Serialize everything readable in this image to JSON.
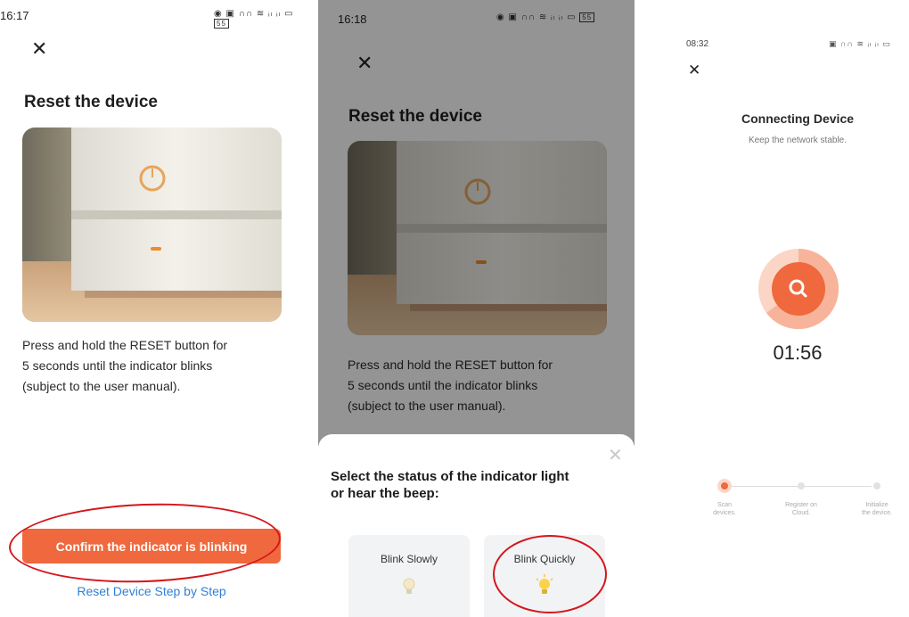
{
  "panel1": {
    "time": "16:17",
    "status_icons": "◉ ▣ ∩∩ ≋ ᵢₗ ᵢₗ ▭",
    "battery": "55",
    "title": "Reset the device",
    "description_lines": [
      "Press and hold the RESET button for",
      "5 seconds until the indicator blinks",
      "(subject to the user manual)."
    ],
    "confirm_label": "Confirm the indicator is blinking",
    "link_label": "Reset Device Step by Step"
  },
  "panel2": {
    "time": "16:18",
    "battery": "55",
    "title": "Reset the device",
    "description_lines": [
      "Press and hold the RESET button for",
      "5 seconds until the indicator blinks",
      "(subject to the user manual)."
    ],
    "sheet_title_lines": [
      "Select the status of the indicator light",
      "or hear the beep:"
    ],
    "options": [
      {
        "label": "Blink Slowly"
      },
      {
        "label": "Blink Quickly"
      }
    ]
  },
  "panel3": {
    "time": "08:32",
    "title": "Connecting Device",
    "subtitle": "Keep the network stable.",
    "timer": "01:56",
    "steps": [
      {
        "label_lines": [
          "Scan",
          "devices."
        ]
      },
      {
        "label_lines": [
          "Register on",
          "Cloud."
        ]
      },
      {
        "label_lines": [
          "Initialize",
          "the device."
        ]
      }
    ]
  },
  "colors": {
    "accent": "#f0683d",
    "link": "#2f7fd6",
    "highlight": "#d4161b"
  }
}
